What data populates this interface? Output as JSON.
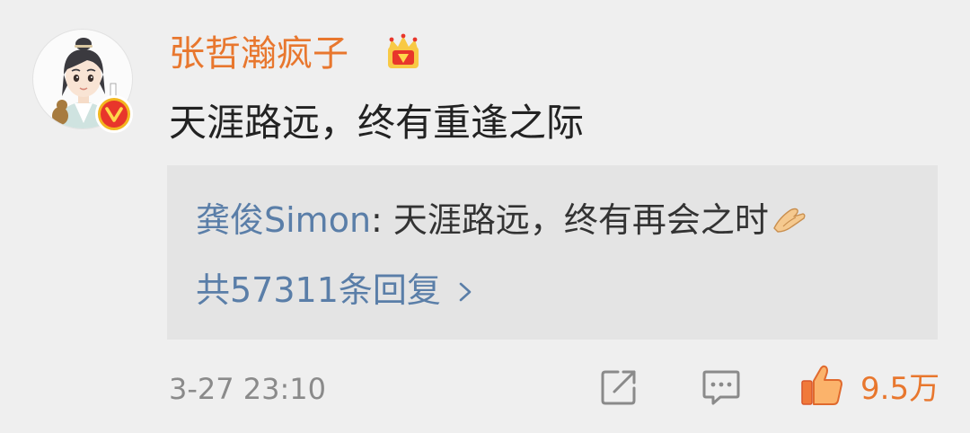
{
  "comment": {
    "username": "张哲瀚疯子",
    "text": "天涯路远，终有重逢之际",
    "timestamp": "3-27 23:10",
    "like_count": "9.5万",
    "icons": {
      "avatar": "cartoon-avatar",
      "verified": "verified-v-icon",
      "vip": "crown-icon",
      "share": "share-icon",
      "reply": "comment-icon",
      "like": "thumbs-up-icon"
    },
    "colors": {
      "username": "#e8772e",
      "link": "#5a7ea8",
      "like": "#e8772e",
      "background": "#efefef",
      "reply_box": "#e4e4e4"
    }
  },
  "reply": {
    "author": "龚俊Simon",
    "separator": ": ",
    "text": "天涯路远，终有再会之时",
    "emoji": "pray-icon",
    "count_label": "共57311条回复",
    "chevron": "chevron-right-icon"
  }
}
